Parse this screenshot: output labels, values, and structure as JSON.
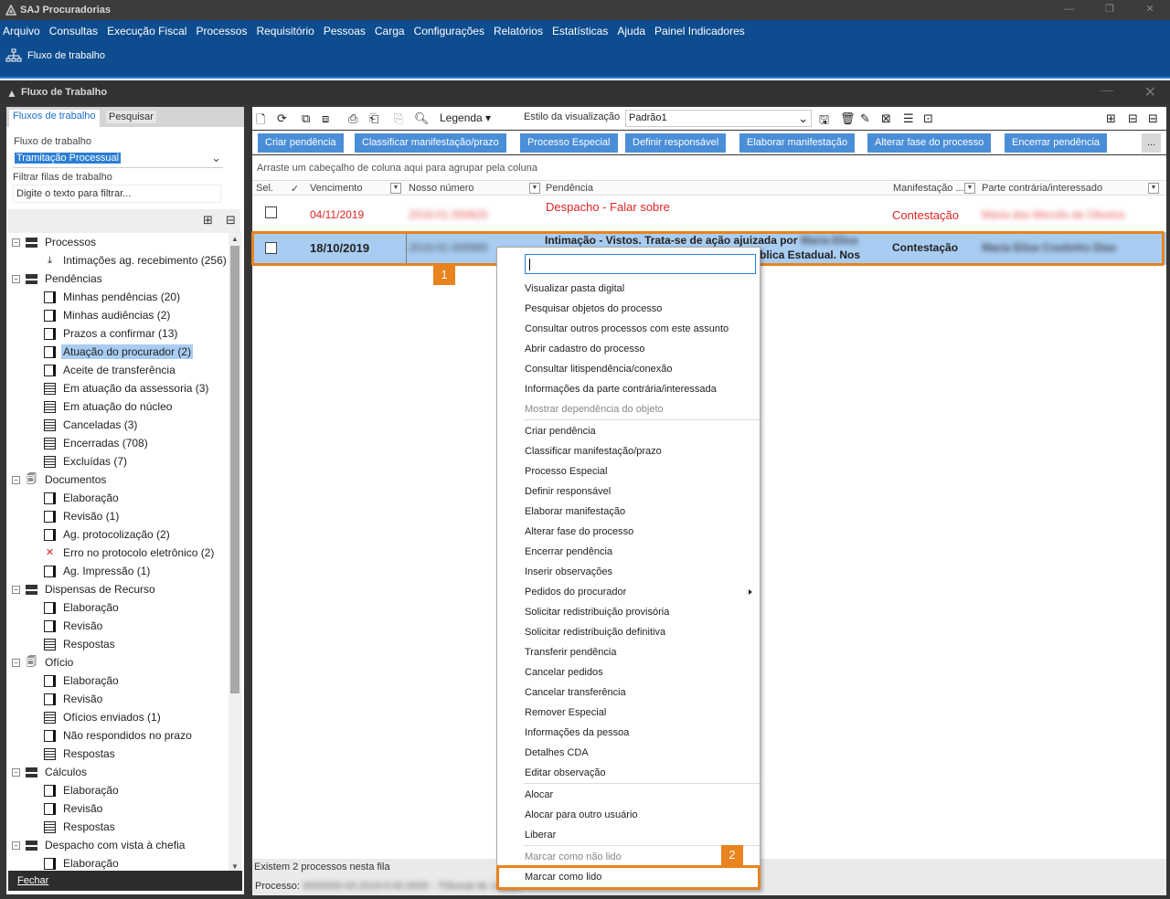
{
  "app_title": "SAJ Procuradorias",
  "menu": [
    "Arquivo",
    "Consultas",
    "Execução Fiscal",
    "Processos",
    "Requisitório",
    "Pessoas",
    "Carga",
    "Configurações",
    "Relatórios",
    "Estatísticas",
    "Ajuda",
    "Painel Indicadores"
  ],
  "flow_button": "Fluxo de trabalho",
  "panel_title": "Fluxo de Trabalho",
  "left": {
    "tabs": [
      "Fluxos de trabalho",
      "Pesquisar"
    ],
    "flow_label": "Fluxo de trabalho",
    "flow_value": "Tramitação Processual",
    "filter_label": "Filtrar filas de trabalho",
    "filter_placeholder": "Digite o texto para filtrar...",
    "close_label": "Fechar"
  },
  "tree": [
    {
      "level": 0,
      "expand": "−",
      "icon": "folder",
      "label": "Processos"
    },
    {
      "level": 1,
      "icon": "download",
      "label": "Intimações ag. recebimento (256)"
    },
    {
      "level": 0,
      "expand": "−",
      "icon": "folder",
      "label": "Pendências"
    },
    {
      "level": 1,
      "icon": "page",
      "label": "Minhas pendências (20)"
    },
    {
      "level": 1,
      "icon": "page",
      "label": "Minhas audiências (2)"
    },
    {
      "level": 1,
      "icon": "page",
      "label": "Prazos a confirmar (13)"
    },
    {
      "level": 1,
      "icon": "page",
      "label": "Atuação do procurador (2)",
      "selected": true
    },
    {
      "level": 1,
      "icon": "page",
      "label": "Aceite de transferência"
    },
    {
      "level": 1,
      "icon": "box",
      "label": "Em atuação da assessoria (3)"
    },
    {
      "level": 1,
      "icon": "box",
      "label": "Em atuação do núcleo"
    },
    {
      "level": 1,
      "icon": "box",
      "label": "Canceladas (3)"
    },
    {
      "level": 1,
      "icon": "box",
      "label": "Encerradas (708)"
    },
    {
      "level": 1,
      "icon": "box",
      "label": "Excluídas (7)"
    },
    {
      "level": 0,
      "expand": "−",
      "icon": "doc",
      "label": "Documentos"
    },
    {
      "level": 1,
      "icon": "page",
      "label": "Elaboração"
    },
    {
      "level": 1,
      "icon": "page",
      "label": "Revisão (1)"
    },
    {
      "level": 1,
      "icon": "page",
      "label": "Ag. protocolização (2)"
    },
    {
      "level": 1,
      "icon": "x",
      "label": "Erro no protocolo eletrônico (2)"
    },
    {
      "level": 1,
      "icon": "page",
      "label": "Ag. Impressão (1)"
    },
    {
      "level": 0,
      "expand": "−",
      "icon": "folder",
      "label": "Dispensas de Recurso"
    },
    {
      "level": 1,
      "icon": "page",
      "label": "Elaboração"
    },
    {
      "level": 1,
      "icon": "page",
      "label": "Revisão"
    },
    {
      "level": 1,
      "icon": "box",
      "label": "Respostas"
    },
    {
      "level": 0,
      "expand": "−",
      "icon": "doc",
      "label": "Ofício"
    },
    {
      "level": 1,
      "icon": "page",
      "label": "Elaboração"
    },
    {
      "level": 1,
      "icon": "page",
      "label": "Revisão"
    },
    {
      "level": 1,
      "icon": "box",
      "label": "Ofícios enviados (1)"
    },
    {
      "level": 1,
      "icon": "page",
      "label": "Não respondidos no prazo"
    },
    {
      "level": 1,
      "icon": "box",
      "label": "Respostas"
    },
    {
      "level": 0,
      "expand": "−",
      "icon": "folder",
      "label": "Cálculos"
    },
    {
      "level": 1,
      "icon": "page",
      "label": "Elaboração"
    },
    {
      "level": 1,
      "icon": "page",
      "label": "Revisão"
    },
    {
      "level": 1,
      "icon": "box",
      "label": "Respostas"
    },
    {
      "level": 0,
      "expand": "−",
      "icon": "folder",
      "label": "Despacho com vista à chefia"
    },
    {
      "level": 1,
      "icon": "page",
      "label": "Elaboração"
    }
  ],
  "toolbar": {
    "legend": "Legenda",
    "style_label": "Estilo da visualização",
    "style_value": "Padrão1"
  },
  "actions": [
    "Criar pendência",
    "Classificar manifestação/prazo",
    "Processo Especial",
    "Definir responsável",
    "Elaborar manifestação",
    "Alterar fase do processo",
    "Encerrar pendência",
    "..."
  ],
  "grid": {
    "group_hint": "Arraste um cabeçalho de coluna aqui para agrupar pela coluna",
    "columns": [
      "Sel.",
      "Vencimento",
      "Nosso número",
      "Pendência",
      "Manifestação ...",
      "Parte contrária/interessado"
    ],
    "rows": [
      {
        "vencimento": "04/11/2019",
        "nosso_numero": "2019.01.000825",
        "pendencia": "Despacho - Falar sobre",
        "manifestacao": "Contestação",
        "parte": "Maria das Mercês de Oliveira"
      },
      {
        "vencimento": "18/10/2019",
        "nosso_numero": "2019.01.000680",
        "pendencia": "Intimação - Vistos. Trata-se de ação ajuizada por",
        "pendencia_tail": "Maria Elisa",
        "pendencia_line2": "blica Estadual. Nos",
        "manifestacao": "Contestação",
        "parte": "Maria Elisa Coutinho Dias"
      }
    ],
    "footer_count": "Existem 2 processos nesta fila",
    "footer_process_label": "Processo:",
    "footer_process_value": "0000000-00.2019.8.00.0000 - Tribunal de Justiça"
  },
  "context_menu": [
    {
      "label": "Visualizar pasta digital"
    },
    {
      "label": "Pesquisar objetos do processo"
    },
    {
      "label": "Consultar outros processos com este assunto"
    },
    {
      "label": "Abrir cadastro do processo"
    },
    {
      "label": "Consultar litispendência/conexão"
    },
    {
      "label": "Informações da parte contrária/interessada"
    },
    {
      "label": "Mostrar dependência do objeto",
      "disabled": true
    },
    {
      "sep": true
    },
    {
      "label": "Criar pendência"
    },
    {
      "label": "Classificar manifestação/prazo"
    },
    {
      "label": "Processo Especial"
    },
    {
      "label": "Definir responsável"
    },
    {
      "label": "Elaborar manifestação"
    },
    {
      "label": "Alterar fase do processo"
    },
    {
      "label": "Encerrar pendência"
    },
    {
      "label": "Inserir observações"
    },
    {
      "label": "Pedidos do procurador",
      "submenu": true
    },
    {
      "label": "Solicitar redistribuição provisória"
    },
    {
      "label": "Solicitar redistribuição definitiva"
    },
    {
      "label": "Transferir pendência"
    },
    {
      "label": "Cancelar pedidos"
    },
    {
      "label": "Cancelar transferência"
    },
    {
      "label": "Remover Especial"
    },
    {
      "label": "Informações da pessoa"
    },
    {
      "label": "Detalhes CDA"
    },
    {
      "label": "Editar observação"
    },
    {
      "sep": true
    },
    {
      "label": "Alocar"
    },
    {
      "label": "Alocar para outro usuário"
    },
    {
      "label": "Liberar"
    },
    {
      "sep": true
    },
    {
      "label": "Marcar como não lido",
      "disabled": true
    },
    {
      "label": "Marcar como lido"
    }
  ],
  "badges": [
    "1",
    "2"
  ],
  "colors": {
    "accent": "#0d4c8e",
    "highlight": "#e8831e",
    "selection": "#a9cdf2",
    "button": "#4a8ed8",
    "error": "#e02424"
  }
}
